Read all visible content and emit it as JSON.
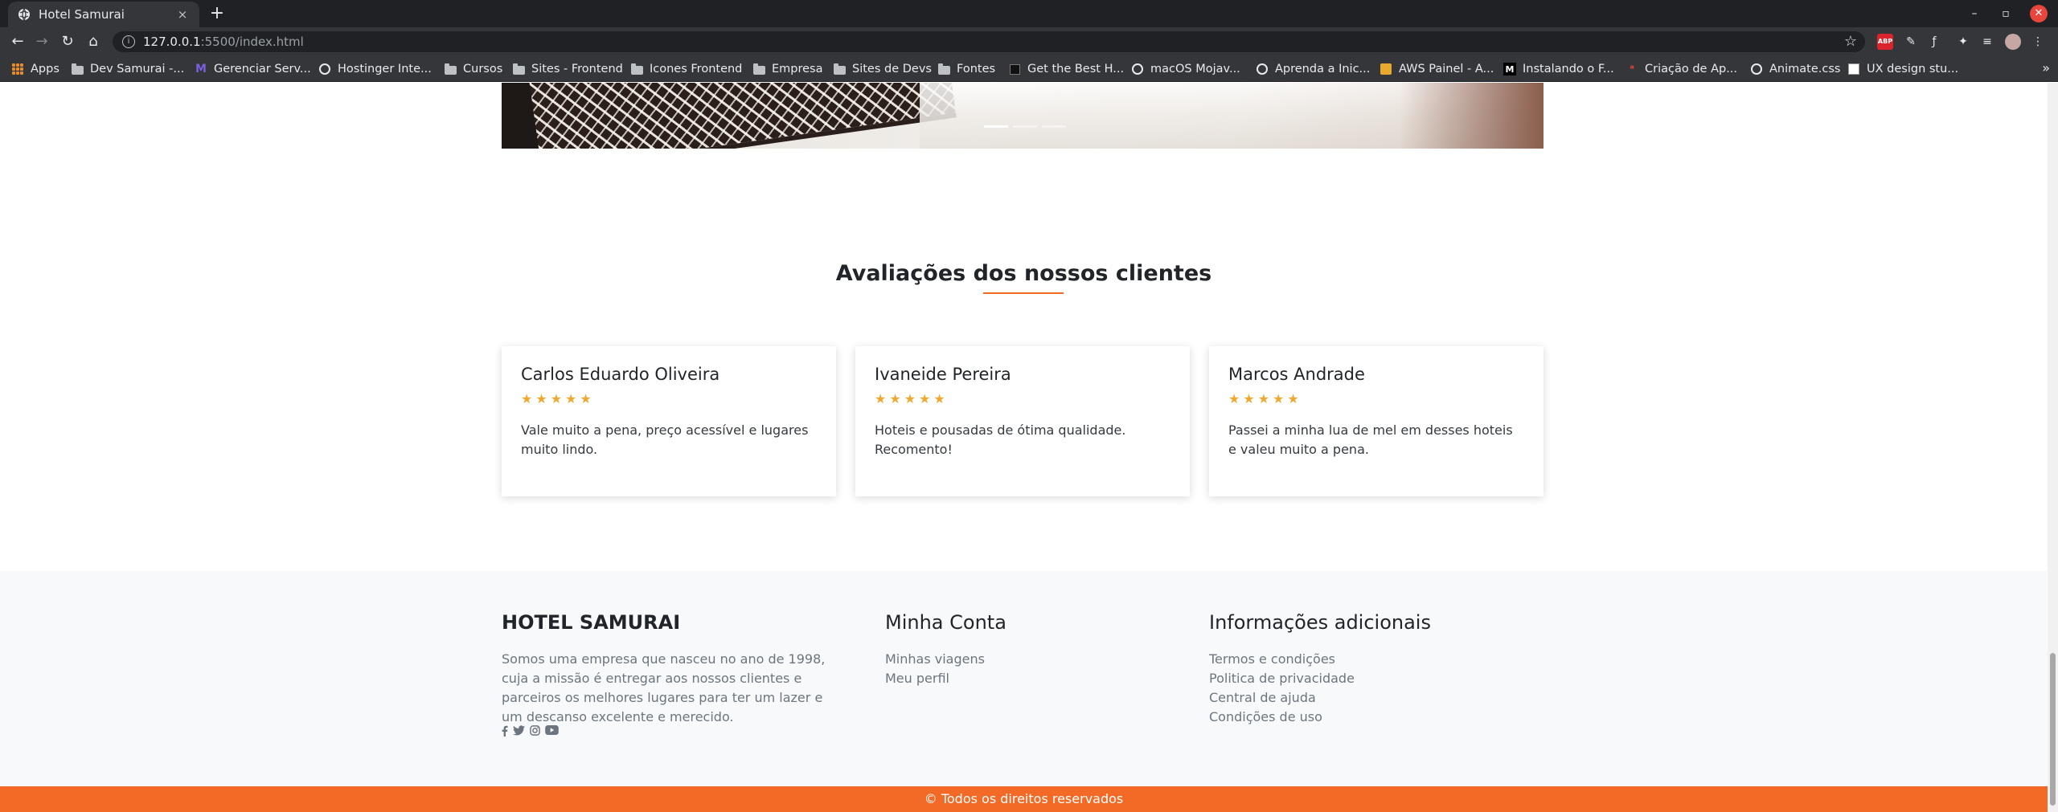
{
  "browser": {
    "tab_title": "Hotel Samurai",
    "tab_close": "×",
    "new_tab": "+",
    "url_host": "127.0.0.1",
    "url_rest": ":5500/index.html",
    "window_controls": [
      "–",
      "▫",
      "✕"
    ],
    "bookmarks": [
      {
        "label": "Apps",
        "icon": "apps-grid-icon"
      },
      {
        "label": "Dev Samurai -...",
        "icon": "folder-icon"
      },
      {
        "label": "Gerenciar Serv...",
        "icon": "site-icon"
      },
      {
        "label": "Hostinger Inte...",
        "icon": "globe-icon"
      },
      {
        "label": "Cursos",
        "icon": "folder-icon"
      },
      {
        "label": "Sites - Frontend",
        "icon": "folder-icon"
      },
      {
        "label": "Icones Frontend",
        "icon": "folder-icon"
      },
      {
        "label": "Empresa",
        "icon": "folder-icon"
      },
      {
        "label": "Sites de Devs",
        "icon": "folder-icon"
      },
      {
        "label": "Fontes",
        "icon": "folder-icon"
      },
      {
        "label": "Get the Best H...",
        "icon": "site-icon"
      },
      {
        "label": "macOS Mojav...",
        "icon": "globe-icon"
      },
      {
        "label": "Aprenda a Inic...",
        "icon": "globe-icon"
      },
      {
        "label": "AWS Painel - A...",
        "icon": "aws-icon"
      },
      {
        "label": "Instalando o F...",
        "icon": "medium-icon"
      },
      {
        "label": "Criação de Ap...",
        "icon": "site-icon"
      },
      {
        "label": "Animate.css",
        "icon": "globe-icon"
      },
      {
        "label": "UX design stu...",
        "icon": "site-icon"
      }
    ],
    "bookmarks_more": "»"
  },
  "colors": {
    "accent": "#f26a25",
    "star": "#f0a830",
    "footer_bg": "#f8f9fa"
  },
  "reviews_section": {
    "title": "Avaliações dos nossos clientes",
    "reviews": [
      {
        "name": "Carlos Eduardo Oliveira",
        "rating": 5,
        "stars": "★★★★★",
        "text": "Vale muito a pena, preço acessível e lugares muito lindo."
      },
      {
        "name": "Ivaneide Pereira",
        "rating": 5,
        "stars": "★★★★★",
        "text": "Hoteis e pousadas de ótima qualidade. Recomento!"
      },
      {
        "name": "Marcos Andrade",
        "rating": 5,
        "stars": "★★★★★",
        "text": "Passei a minha lua de mel em desses hoteis e valeu muito a pena."
      }
    ]
  },
  "footer": {
    "about": {
      "title": "HOTEL SAMURAI",
      "text": "Somos uma empresa que nasceu no ano de 1998, cuja a missão é entregar aos nossos clientes e parceiros os melhores lugares para ter um lazer e um descanso excelente e merecido.",
      "social": [
        "facebook-icon",
        "twitter-icon",
        "instagram-icon",
        "youtube-icon"
      ]
    },
    "account": {
      "title": "Minha Conta",
      "links": [
        "Minhas viagens",
        "Meu perfil"
      ]
    },
    "info": {
      "title": "Informações adicionais",
      "links": [
        "Termos e condições",
        "Politica de privacidade",
        "Central de ajuda",
        "Condições de uso"
      ]
    },
    "copyright": "© Todos os direitos reservados"
  }
}
